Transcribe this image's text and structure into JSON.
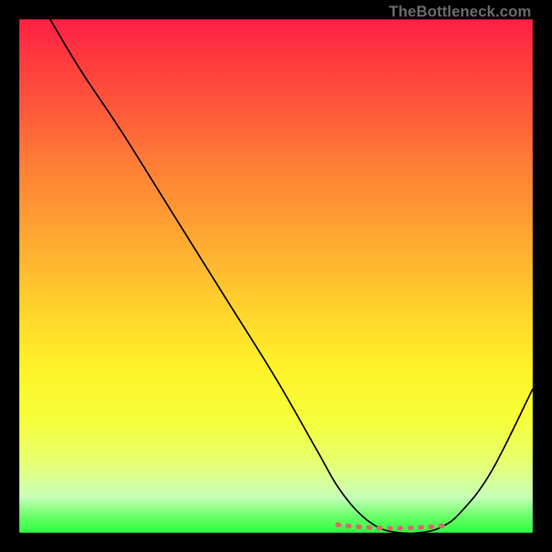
{
  "watermark": "TheBottleneck.com",
  "chart_data": {
    "type": "line",
    "title": "",
    "xlabel": "",
    "ylabel": "",
    "xlim": [
      0,
      100
    ],
    "ylim": [
      0,
      100
    ],
    "grid": false,
    "legend": false,
    "series": [
      {
        "name": "bottleneck-curve",
        "x": [
          6,
          12,
          20,
          30,
          40,
          50,
          58,
          62,
          66,
          70,
          74,
          78,
          82,
          86,
          92,
          100
        ],
        "values": [
          100,
          90,
          78,
          62,
          46,
          30,
          16,
          9,
          4,
          1,
          0,
          0,
          1,
          4,
          12,
          28
        ]
      }
    ],
    "annotations": [
      {
        "name": "flat-valley-dots",
        "x_range": [
          62,
          84
        ],
        "y": 1
      }
    ]
  }
}
